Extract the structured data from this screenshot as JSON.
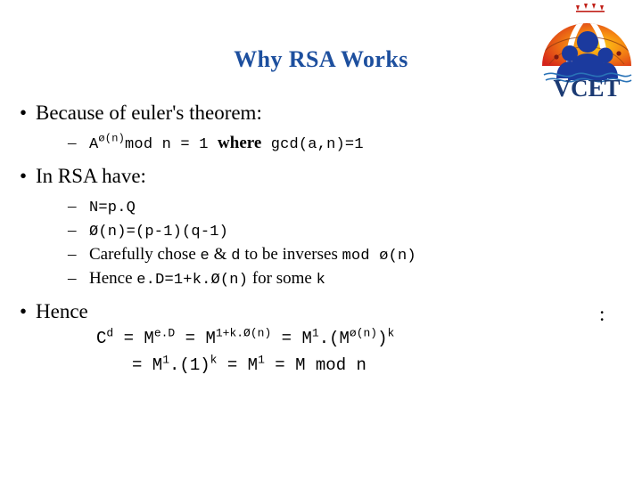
{
  "slide": {
    "title": "Why RSA Works",
    "title_color": "#1d4f9e",
    "background": "#ffffff",
    "text_color": "#000000",
    "trailing_colon": ":"
  },
  "logo": {
    "name": "vcet-logo",
    "wordmark": "VCET",
    "wordmark_color": "#1b3a73",
    "arc_color_outer": "#d9261c",
    "arc_color_inner": "#f7a01a",
    "figure_color": "#1b3a9e",
    "wave_color": "#2a73b7"
  },
  "bullets": [
    {
      "marker": "•",
      "text": "Because of euler's theorem:",
      "sub": [
        {
          "marker": "–",
          "parts": [
            {
              "style": "mono",
              "text": "A"
            },
            {
              "style": "mono-sup",
              "text": "ø(n)"
            },
            {
              "style": "mono",
              "text": "mod n = 1 "
            },
            {
              "style": "serif-bold",
              "text": "where"
            },
            {
              "style": "mono",
              "text": " gcd(a,n)=1"
            }
          ],
          "plain": "Aø(n)mod n = 1 where gcd(a,n)=1"
        }
      ]
    },
    {
      "marker": "•",
      "text": "In RSA have:",
      "sub": [
        {
          "marker": "–",
          "parts": [
            {
              "style": "mono",
              "text": "N=p.Q"
            }
          ],
          "plain": "N=p.Q"
        },
        {
          "marker": "–",
          "parts": [
            {
              "style": "mono",
              "text": "Ø(n)=(p-1)(q-1)"
            }
          ],
          "plain": "Ø(n)=(p-1)(q-1)"
        },
        {
          "marker": "–",
          "parts": [
            {
              "style": "serif",
              "text": "Carefully chose "
            },
            {
              "style": "mono",
              "text": "e"
            },
            {
              "style": "serif",
              "text": " & "
            },
            {
              "style": "mono",
              "text": "d"
            },
            {
              "style": "serif",
              "text": " to be inverses "
            },
            {
              "style": "mono",
              "text": "mod ø(n)"
            }
          ],
          "plain": "Carefully chose e & d to be inverses mod ø(n)"
        },
        {
          "marker": "–",
          "parts": [
            {
              "style": "serif",
              "text": "Hence "
            },
            {
              "style": "mono",
              "text": "e.D=1+k.Ø(n)"
            },
            {
              "style": "serif",
              "text": " for some "
            },
            {
              "style": "mono",
              "text": "k"
            }
          ],
          "plain": "Hence e.D=1+k.Ø(n) for some k"
        }
      ]
    },
    {
      "marker": "•",
      "text": "Hence",
      "sub": []
    }
  ],
  "equations": {
    "line1": {
      "base": "C",
      "sup1": "d",
      "op1": " = M",
      "sup2": "e.D",
      "op2": " = M",
      "sup3": "1+k.Ø(n)",
      "op3": " = M",
      "sup4": "1",
      "op4": ".(M",
      "sup5": "ø(n)",
      "op5": ")",
      "sup6": "k",
      "plain": "C^d = M^e.D = M^1+k.Ø(n) = M^1.(M^ø(n))^k"
    },
    "line2": {
      "op1": "= M",
      "sup1": "1",
      "op2": ".(1)",
      "sup2": "k",
      "op3": " = M",
      "sup3": "1",
      "op4": " = M mod n",
      "plain": "= M^1.(1)^k = M^1 = M mod n"
    }
  }
}
